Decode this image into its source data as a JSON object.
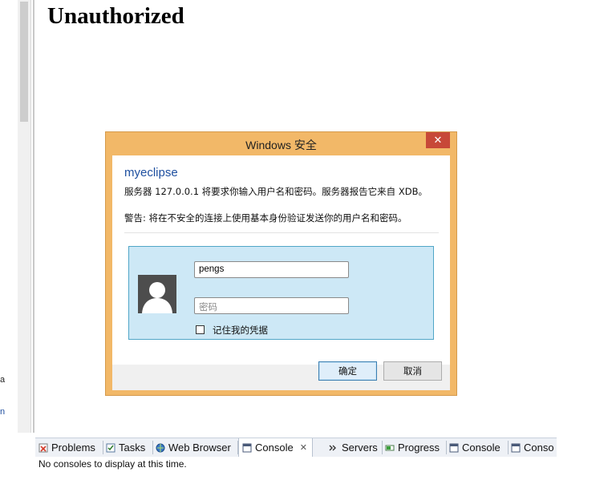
{
  "page": {
    "heading": "Unauthorized"
  },
  "left_edge": {
    "char_a": "a",
    "char_n": "n"
  },
  "dialog": {
    "title": "Windows 安全",
    "close_glyph": "✕",
    "app_name": "myeclipse",
    "message": "服务器 127.0.0.1 将要求你输入用户名和密码。服务器报告它来自 XDB。",
    "warning": "警告: 将在不安全的连接上使用基本身份验证发送你的用户名和密码。",
    "username_value": "pengs",
    "password_placeholder": "密码",
    "remember_label": "记住我的凭据",
    "remember_checked": false,
    "ok_label": "确定",
    "cancel_label": "取消"
  },
  "views": {
    "tabs": [
      {
        "label": "Problems",
        "icon": "problems-icon"
      },
      {
        "label": "Tasks",
        "icon": "tasks-icon"
      },
      {
        "label": "Web Browser",
        "icon": "globe-icon"
      },
      {
        "label": "Console",
        "icon": "console-icon",
        "active": true
      },
      {
        "label": "Servers",
        "icon": "servers-icon"
      },
      {
        "label": "Progress",
        "icon": "progress-icon"
      },
      {
        "label": "Console",
        "icon": "console-icon"
      },
      {
        "label": "Conso",
        "icon": "console-icon"
      }
    ],
    "close_glyph": "✕",
    "status": "No consoles to display at this time."
  },
  "colors": {
    "dialog_frame": "#f2b868",
    "close_button": "#c74838",
    "credential_tile": "#cde8f6",
    "app_name": "#1f50a0"
  }
}
